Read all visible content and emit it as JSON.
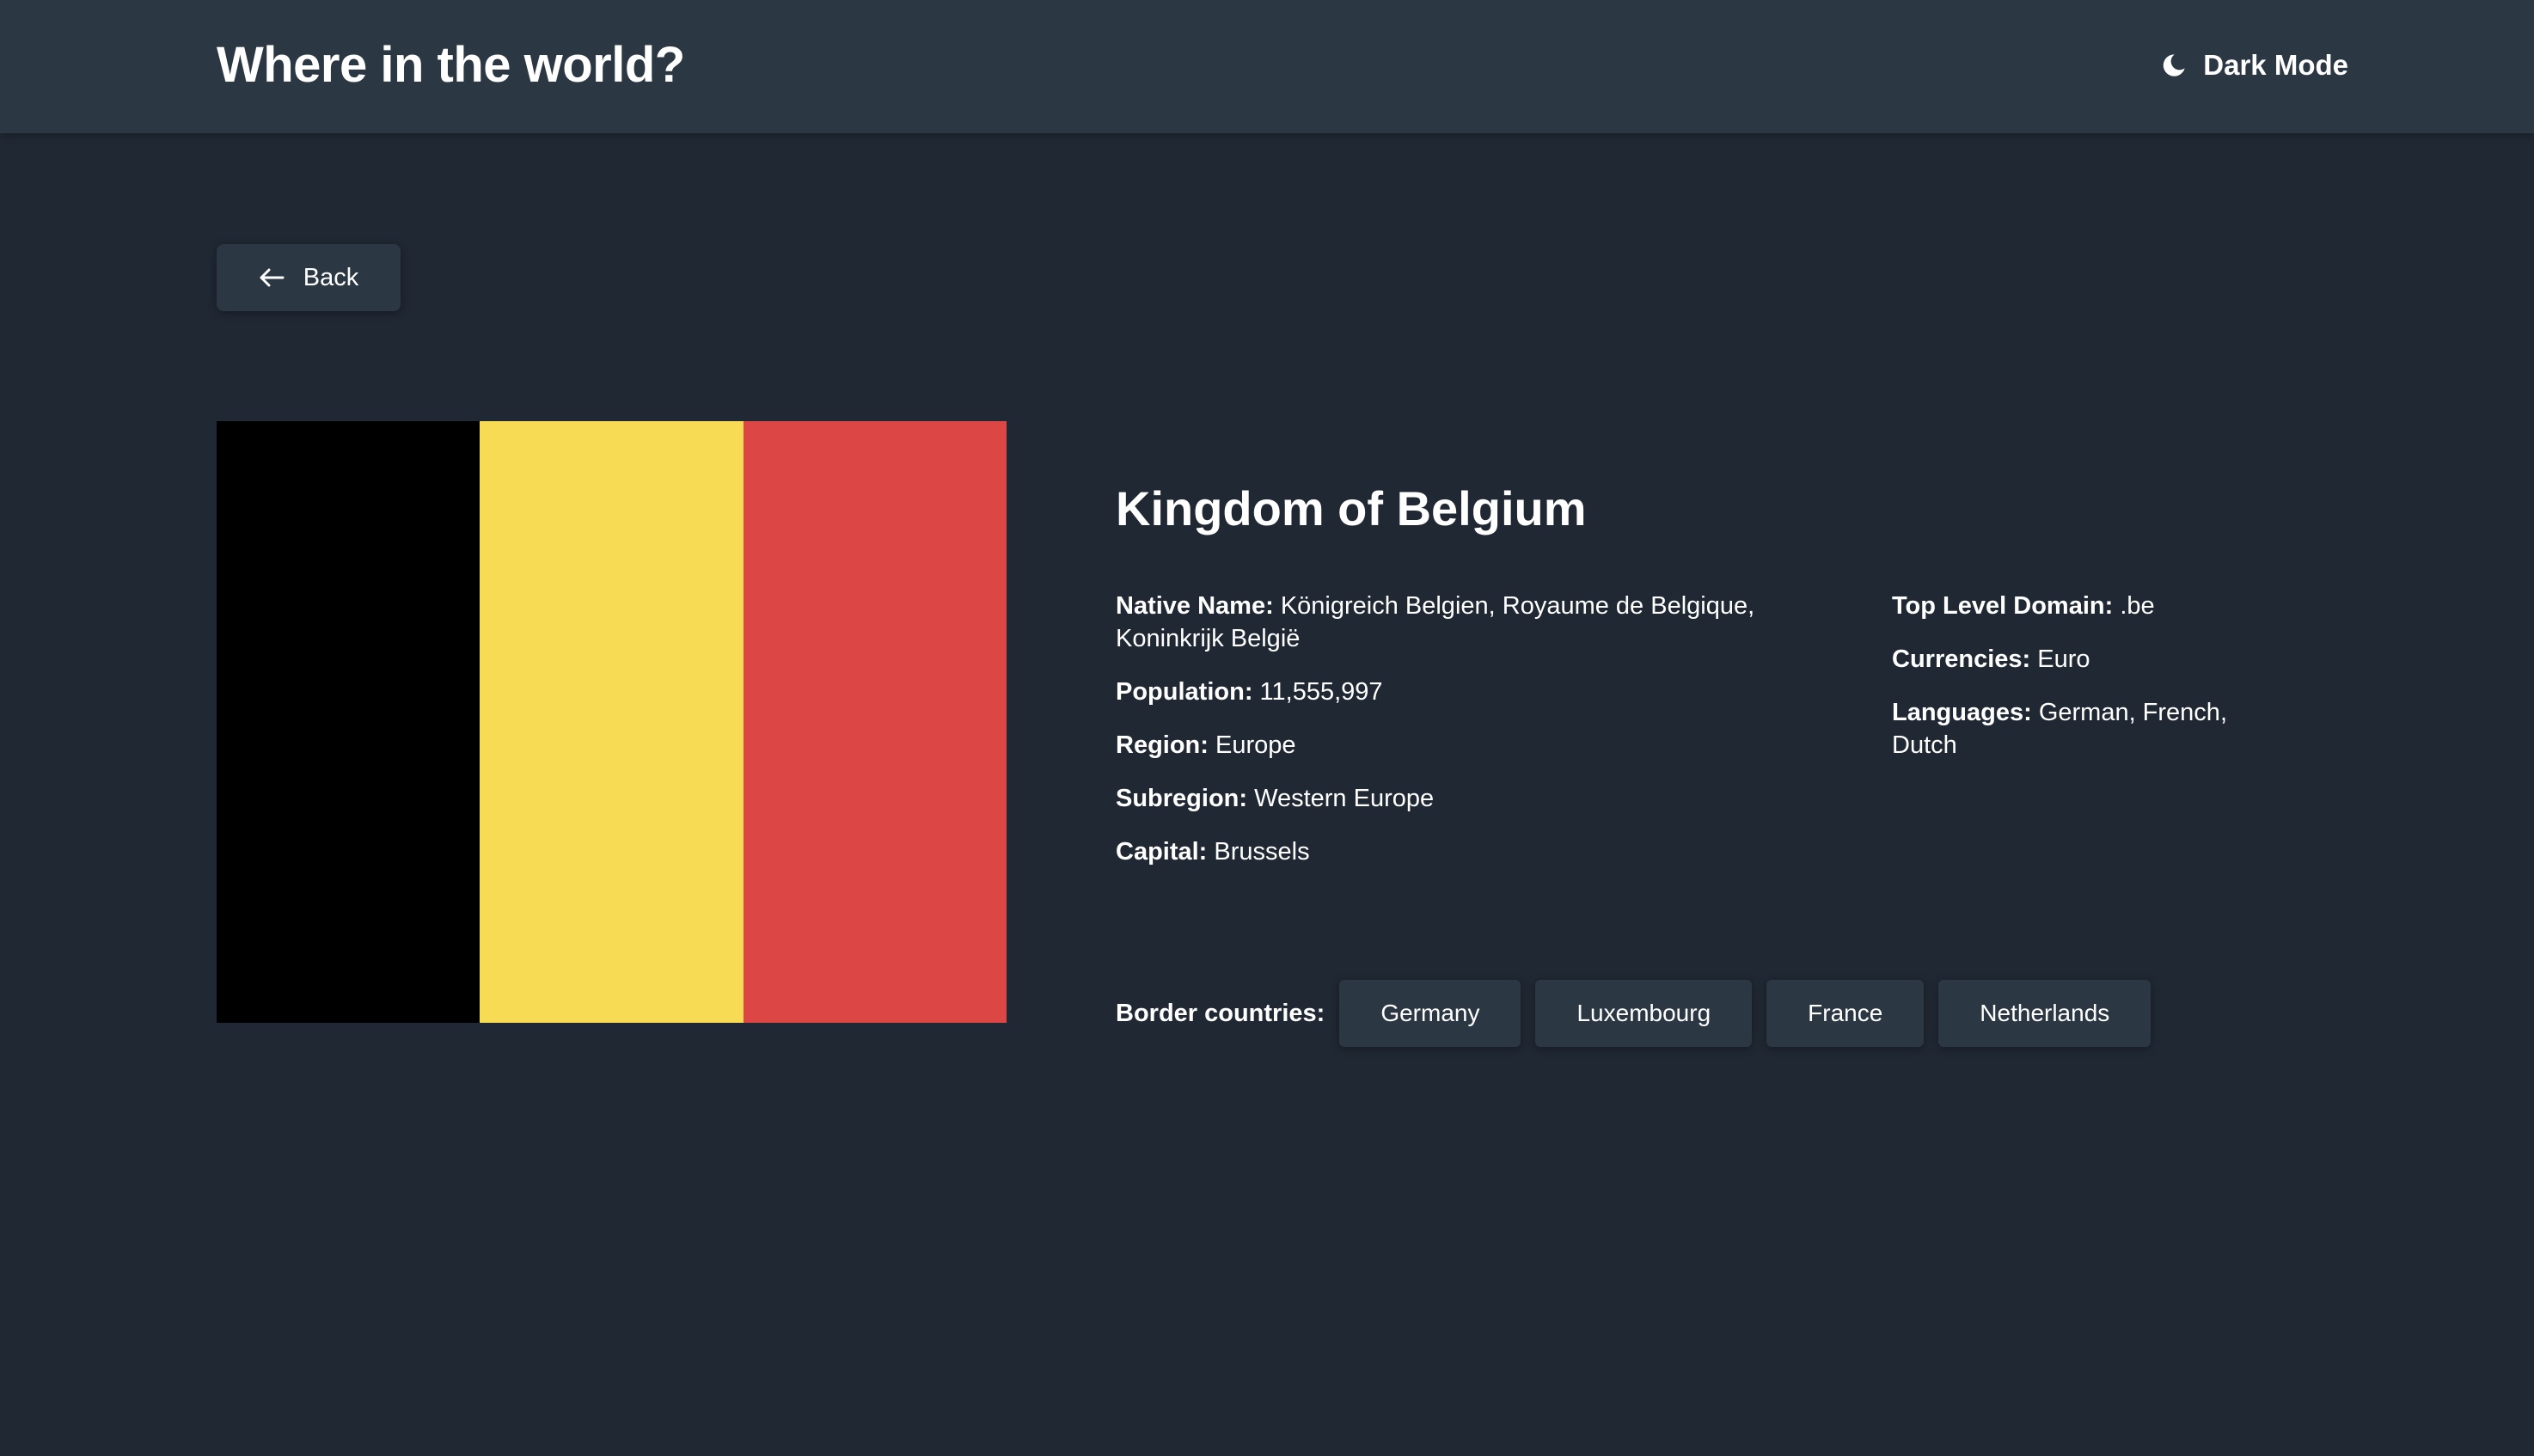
{
  "header": {
    "title": "Where in the world?",
    "mode_label": "Dark Mode",
    "mode_icon": "moon-icon"
  },
  "back": {
    "label": "Back",
    "icon": "arrow-left-icon"
  },
  "colors": {
    "background": "#202833",
    "surface": "#2b3743",
    "text": "#ffffff"
  },
  "flag": {
    "stripes": [
      "#000000",
      "#f7db55",
      "#dc4746"
    ]
  },
  "country": {
    "name": "Kingdom of Belgium",
    "native_name_label": "Native Name:",
    "native_name": "Königreich Belgien, Royaume de Belgique, Koninkrijk België",
    "population_label": "Population:",
    "population": "11,555,997",
    "region_label": "Region:",
    "region": "Europe",
    "subregion_label": "Subregion:",
    "subregion": "Western Europe",
    "capital_label": "Capital:",
    "capital": "Brussels",
    "tld_label": "Top Level Domain:",
    "tld": ".be",
    "currencies_label": "Currencies:",
    "currencies": "Euro",
    "languages_label": "Languages:",
    "languages": "German, French, Dutch"
  },
  "borders": {
    "label": "Border countries:",
    "countries": [
      "Germany",
      "Luxembourg",
      "France",
      "Netherlands"
    ]
  }
}
